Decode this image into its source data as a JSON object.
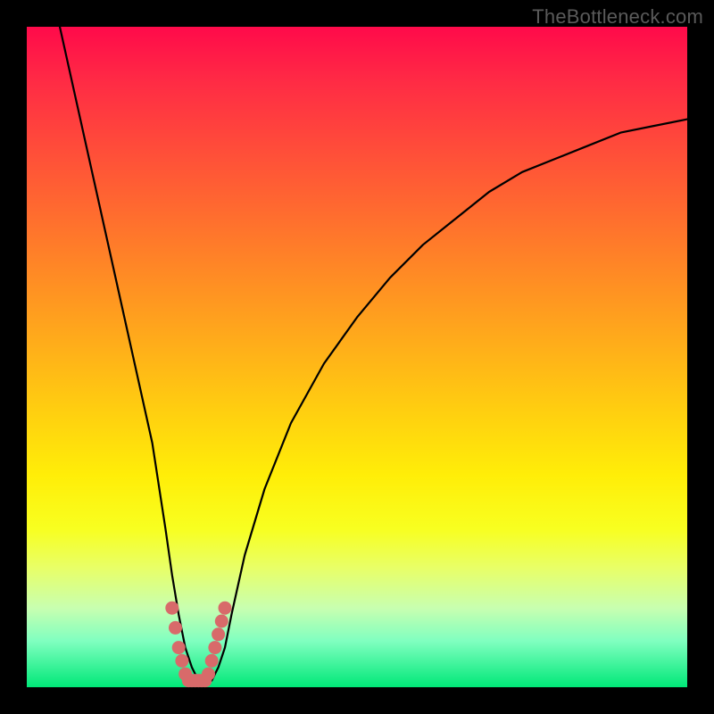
{
  "watermark": "TheBottleneck.com",
  "chart_data": {
    "type": "line",
    "title": "",
    "xlabel": "",
    "ylabel": "",
    "xlim": [
      0,
      100
    ],
    "ylim": [
      0,
      100
    ],
    "grid": false,
    "series": [
      {
        "name": "bottleneck-curve",
        "x": [
          5,
          7,
          9,
          11,
          13,
          15,
          17,
          19,
          21,
          22,
          23,
          24,
          25,
          26,
          27,
          28,
          29,
          30,
          31,
          33,
          36,
          40,
          45,
          50,
          55,
          60,
          65,
          70,
          75,
          80,
          85,
          90,
          95,
          100
        ],
        "y": [
          100,
          91,
          82,
          73,
          64,
          55,
          46,
          37,
          24,
          17,
          11,
          6,
          3,
          1,
          1,
          1,
          3,
          6,
          11,
          20,
          30,
          40,
          49,
          56,
          62,
          67,
          71,
          75,
          78,
          80,
          82,
          84,
          85,
          86
        ]
      },
      {
        "name": "low-bottleneck-markers",
        "x": [
          22,
          22.5,
          23,
          23.5,
          24,
          24.5,
          25,
          25.5,
          26,
          26.5,
          27,
          27.5,
          28,
          28.5,
          29,
          29.5,
          30
        ],
        "y": [
          12,
          9,
          6,
          4,
          2,
          1,
          1,
          1,
          1,
          1,
          1,
          2,
          4,
          6,
          8,
          10,
          12
        ]
      }
    ],
    "background_gradient": {
      "top": "#ff0a4a",
      "bottom": "#00e878"
    },
    "annotations": []
  }
}
